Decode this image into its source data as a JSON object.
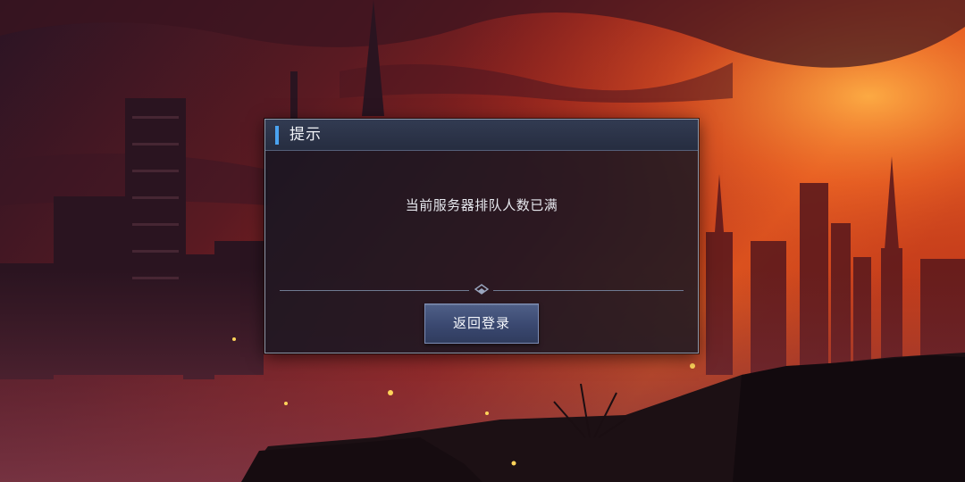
{
  "dialog": {
    "title": "提示",
    "message": "当前服务器排队人数已满",
    "button_label": "返回登录"
  },
  "colors": {
    "accent": "#4aa3f0",
    "button": "#3a4870",
    "dialog_border": "#8d96a8"
  },
  "icons": {
    "divider": "diamond-chevron-icon"
  }
}
